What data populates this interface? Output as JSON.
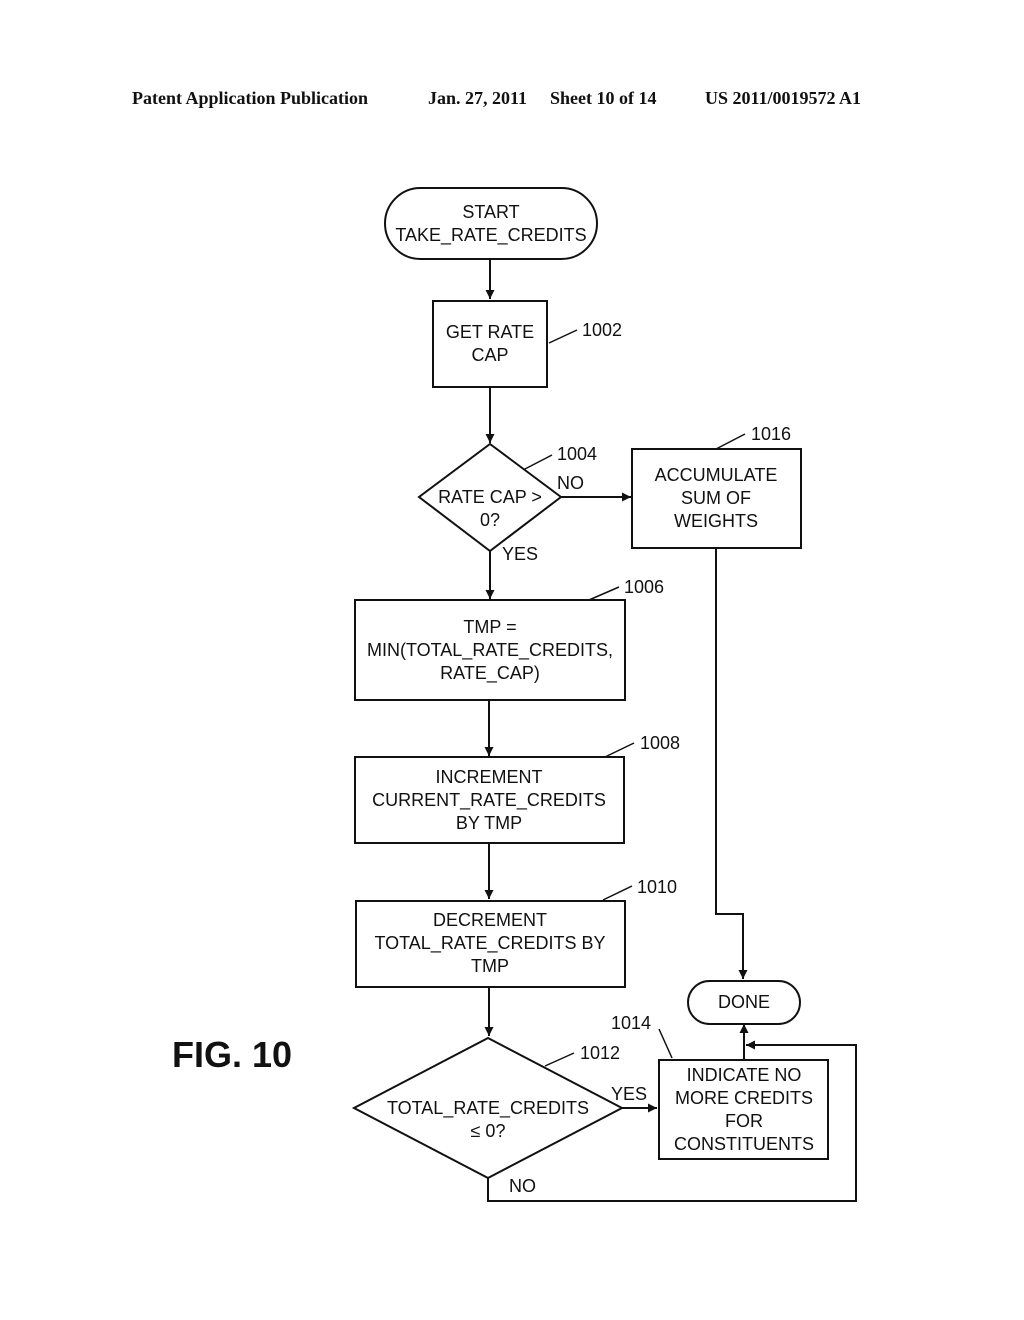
{
  "header": {
    "publication": "Patent Application Publication",
    "date": "Jan. 27, 2011",
    "sheet": "Sheet 10 of 14",
    "number": "US 2011/0019572 A1"
  },
  "figure": {
    "label": "FIG. 10"
  },
  "nodes": {
    "start": {
      "lines": [
        "START",
        "TAKE_RATE_CREDITS"
      ]
    },
    "n1002": {
      "ref": "1002",
      "lines": [
        "GET RATE",
        "CAP"
      ]
    },
    "n1004": {
      "ref": "1004",
      "lines": [
        "RATE CAP >",
        "0?"
      ],
      "yes_label": "YES",
      "no_label": "NO"
    },
    "n1006": {
      "ref": "1006",
      "lines": [
        "TMP =",
        "MIN(TOTAL_RATE_CREDITS,",
        "RATE_CAP)"
      ]
    },
    "n1008": {
      "ref": "1008",
      "lines": [
        "INCREMENT",
        "CURRENT_RATE_CREDITS",
        "BY TMP"
      ]
    },
    "n1010": {
      "ref": "1010",
      "lines": [
        "DECREMENT",
        "TOTAL_RATE_CREDITS BY",
        "TMP"
      ]
    },
    "n1012": {
      "ref": "1012",
      "lines": [
        "TOTAL_RATE_CREDITS",
        "≤ 0?"
      ],
      "yes_label": "YES",
      "no_label": "NO"
    },
    "n1014": {
      "ref": "1014",
      "lines": [
        "INDICATE NO",
        "MORE CREDITS",
        "FOR",
        "CONSTITUENTS"
      ]
    },
    "n1016": {
      "ref": "1016",
      "lines": [
        "ACCUMULATE",
        "SUM OF",
        "WEIGHTS"
      ]
    },
    "done": {
      "lines": [
        "DONE"
      ]
    }
  }
}
